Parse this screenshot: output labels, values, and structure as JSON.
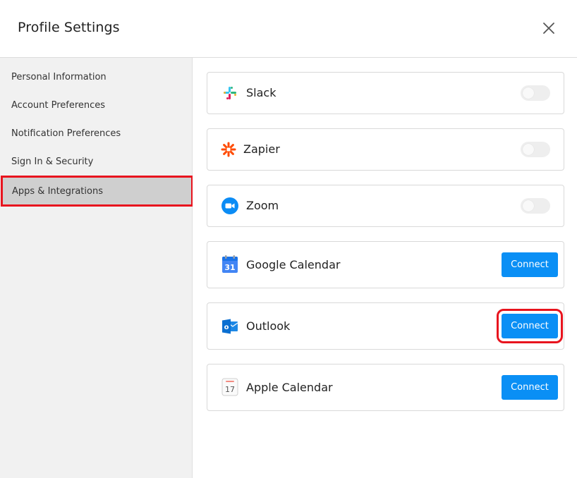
{
  "header": {
    "title": "Profile Settings",
    "close_icon": "close-icon"
  },
  "sidebar": {
    "items": [
      {
        "label": "Personal Information"
      },
      {
        "label": "Account Preferences"
      },
      {
        "label": "Notification Preferences"
      },
      {
        "label": "Sign In & Security"
      },
      {
        "label": "Apps & Integrations",
        "active": true
      }
    ]
  },
  "integrations": [
    {
      "name": "Slack",
      "icon": "slack-icon",
      "control": "toggle",
      "enabled": false
    },
    {
      "name": "Zapier",
      "icon": "zapier-icon",
      "control": "toggle",
      "enabled": false
    },
    {
      "name": "Zoom",
      "icon": "zoom-icon",
      "control": "toggle",
      "enabled": false
    },
    {
      "name": "Google Calendar",
      "icon": "google-calendar-icon",
      "control": "button",
      "button_label": "Connect",
      "icon_text": "31"
    },
    {
      "name": "Outlook",
      "icon": "outlook-icon",
      "control": "button",
      "button_label": "Connect",
      "icon_text": "o"
    },
    {
      "name": "Apple Calendar",
      "icon": "apple-calendar-icon",
      "control": "button",
      "button_label": "Connect",
      "icon_text": "17"
    }
  ],
  "colors": {
    "accent": "#0a8ff5",
    "highlight": "#e8141e",
    "sidebar_bg": "#f1f1f1",
    "sidebar_active": "#cfcfcf"
  }
}
